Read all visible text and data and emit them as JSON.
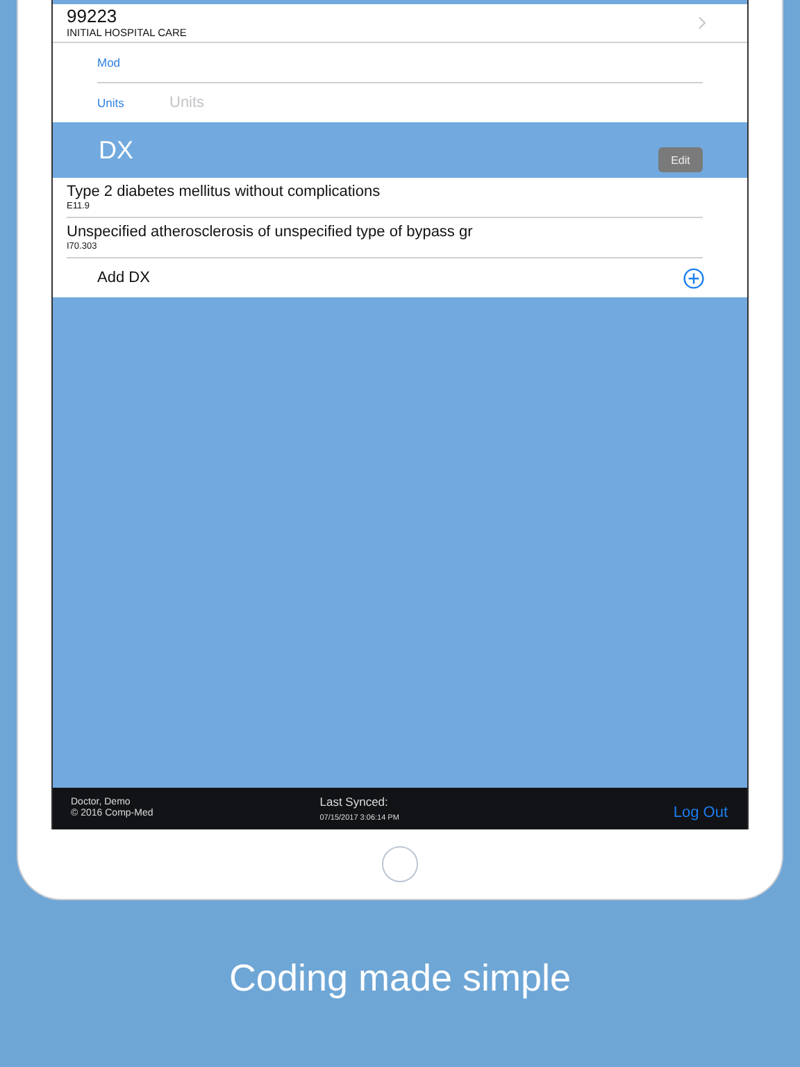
{
  "procedure": {
    "code": "99223",
    "description": "INITIAL HOSPITAL CARE"
  },
  "modifier": {
    "label": "Mod"
  },
  "units": {
    "label": "Units",
    "placeholder": "Units"
  },
  "dx_section": {
    "title": "DX",
    "edit_button": "Edit"
  },
  "diagnoses": [
    {
      "description": "Type 2 diabetes mellitus without complications",
      "code": "E11.9"
    },
    {
      "description": "Unspecified atherosclerosis of unspecified type of bypass gr",
      "code": "I70.303"
    }
  ],
  "add_dx": {
    "label": "Add DX"
  },
  "footer": {
    "user": "Doctor, Demo",
    "copyright": "© 2016 Comp-Med",
    "sync_label": "Last Synced:",
    "sync_time": "07/15/2017 3:06:14 PM",
    "logout": "Log Out"
  },
  "caption": "Coding made simple"
}
